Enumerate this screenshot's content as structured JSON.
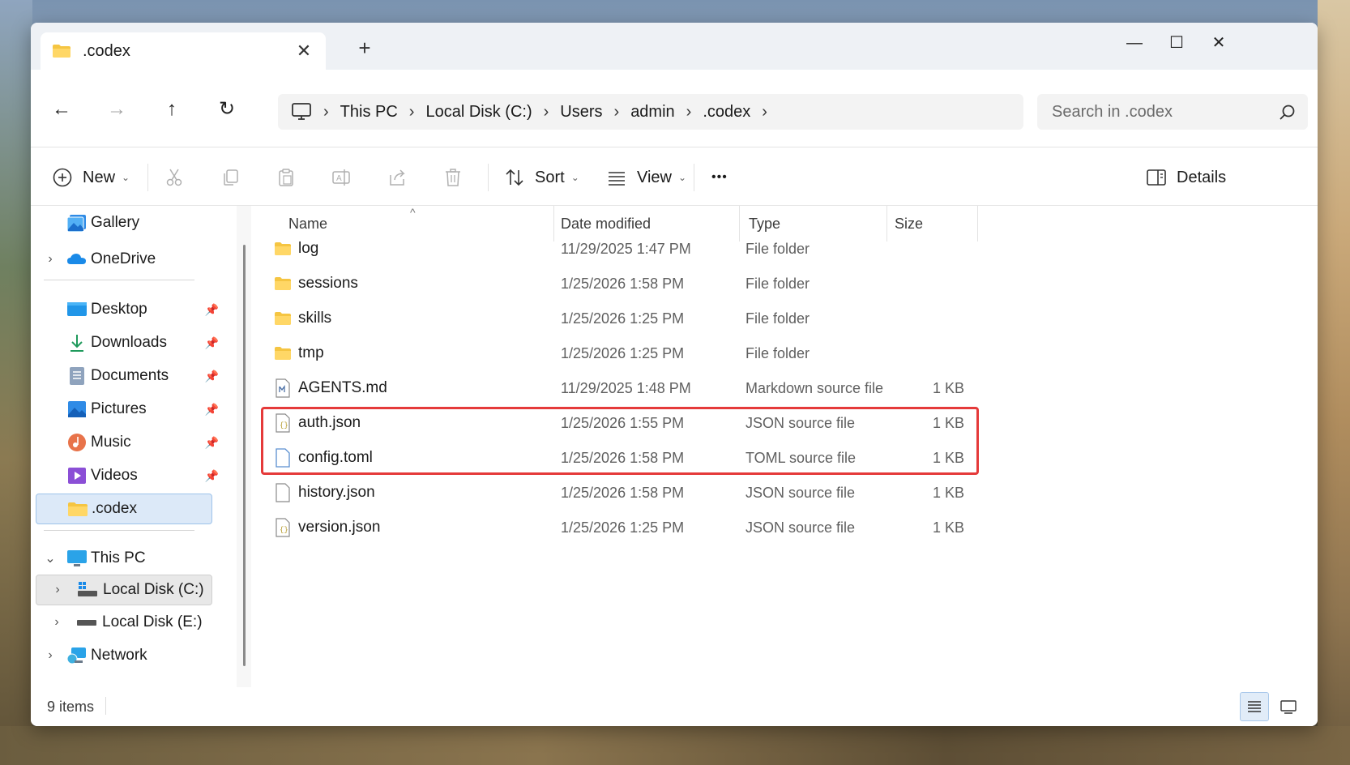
{
  "window": {
    "tab_title": ".codex",
    "tab_close": "✕",
    "new_tab": "+",
    "minimize": "—",
    "maximize": "☐",
    "close": "✕"
  },
  "nav": {
    "back": "←",
    "forward": "→",
    "up": "↑",
    "refresh": "↻",
    "breadcrumb": [
      "This PC",
      "Local Disk (C:)",
      "Users",
      "admin",
      ".codex"
    ],
    "separator": "›"
  },
  "search": {
    "placeholder": "Search in .codex",
    "value": ""
  },
  "toolbar": {
    "new_label": "New",
    "sort_label": "Sort",
    "view_label": "View",
    "more_label": "•••",
    "details_label": "Details",
    "chevron": "⌄"
  },
  "sidebar": {
    "top_items": [
      {
        "label": "Gallery",
        "icon": "gallery-icon"
      },
      {
        "label": "OneDrive",
        "icon": "onedrive-icon"
      }
    ],
    "quick_access": [
      {
        "label": "Desktop",
        "icon": "desktop-icon",
        "pinned": true
      },
      {
        "label": "Downloads",
        "icon": "downloads-icon",
        "pinned": true
      },
      {
        "label": "Documents",
        "icon": "documents-icon",
        "pinned": true
      },
      {
        "label": "Pictures",
        "icon": "pictures-icon",
        "pinned": true
      },
      {
        "label": "Music",
        "icon": "music-icon",
        "pinned": true
      },
      {
        "label": "Videos",
        "icon": "videos-icon",
        "pinned": true
      },
      {
        "label": ".codex",
        "icon": "folder-icon",
        "pinned": false,
        "selected": true
      }
    ],
    "this_pc": {
      "label": "This PC",
      "icon": "this-pc-icon"
    },
    "drives": [
      {
        "label": "Local Disk (C:)",
        "icon": "drive-icon"
      },
      {
        "label": "Local Disk (E:)",
        "icon": "drive-icon"
      }
    ],
    "network": {
      "label": "Network",
      "icon": "network-icon"
    },
    "pin_glyph": "📌",
    "expand_glyph": "›",
    "collapse_glyph": "⌄"
  },
  "columns": {
    "name": "Name",
    "date": "Date modified",
    "type": "Type",
    "size": "Size",
    "sort_caret": "^"
  },
  "files": [
    {
      "name": "log",
      "date": "11/29/2025 1:47 PM",
      "type": "File folder",
      "size": "",
      "kind": "folder"
    },
    {
      "name": "sessions",
      "date": "1/25/2026 1:58 PM",
      "type": "File folder",
      "size": "",
      "kind": "folder"
    },
    {
      "name": "skills",
      "date": "1/25/2026 1:25 PM",
      "type": "File folder",
      "size": "",
      "kind": "folder"
    },
    {
      "name": "tmp",
      "date": "1/25/2026 1:25 PM",
      "type": "File folder",
      "size": "",
      "kind": "folder"
    },
    {
      "name": "AGENTS.md",
      "date": "11/29/2025 1:48 PM",
      "type": "Markdown source file",
      "size": "1 KB",
      "kind": "md"
    },
    {
      "name": "auth.json",
      "date": "1/25/2026 1:55 PM",
      "type": "JSON source file",
      "size": "1 KB",
      "kind": "json"
    },
    {
      "name": "config.toml",
      "date": "1/25/2026 1:58 PM",
      "type": "TOML source file",
      "size": "1 KB",
      "kind": "file"
    },
    {
      "name": "history.json",
      "date": "1/25/2026 1:58 PM",
      "type": "JSON source file",
      "size": "1 KB",
      "kind": "file"
    },
    {
      "name": "version.json",
      "date": "1/25/2026 1:25 PM",
      "type": "JSON source file",
      "size": "1 KB",
      "kind": "json"
    }
  ],
  "status": {
    "item_count": "9 items"
  },
  "colors": {
    "highlight": "#e53a3a",
    "folder": "#f5c542",
    "selection": "#dce9f8",
    "accent": "#0067c0"
  }
}
